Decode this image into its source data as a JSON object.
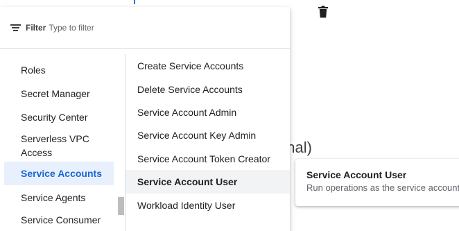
{
  "filter": {
    "label": "Filter",
    "placeholder": "Type to filter"
  },
  "services": [
    {
      "label": "Roles"
    },
    {
      "label": "Secret Manager"
    },
    {
      "label": "Security Center"
    },
    {
      "label": "Serverless VPC Access"
    },
    {
      "label": "Service Accounts",
      "selected": true
    },
    {
      "label": "Service Agents"
    },
    {
      "label": "Service Consumer"
    }
  ],
  "roles": [
    {
      "label": "Create Service Accounts"
    },
    {
      "label": "Delete Service Accounts"
    },
    {
      "label": "Service Account Admin"
    },
    {
      "label": "Service Account Key Admin"
    },
    {
      "label": "Service Account Token Creator"
    },
    {
      "label": "Service Account User",
      "highlighted": true
    },
    {
      "label": "Workload Identity User"
    }
  ],
  "background": {
    "heading_fragment": "tional)",
    "role_card": {
      "title": "Service Account User",
      "description": "Run operations as the service account."
    }
  },
  "colors": {
    "selected_bg": "#e8f0fe",
    "selected_text": "#1967d2",
    "hover_bg": "#f1f3f4"
  }
}
